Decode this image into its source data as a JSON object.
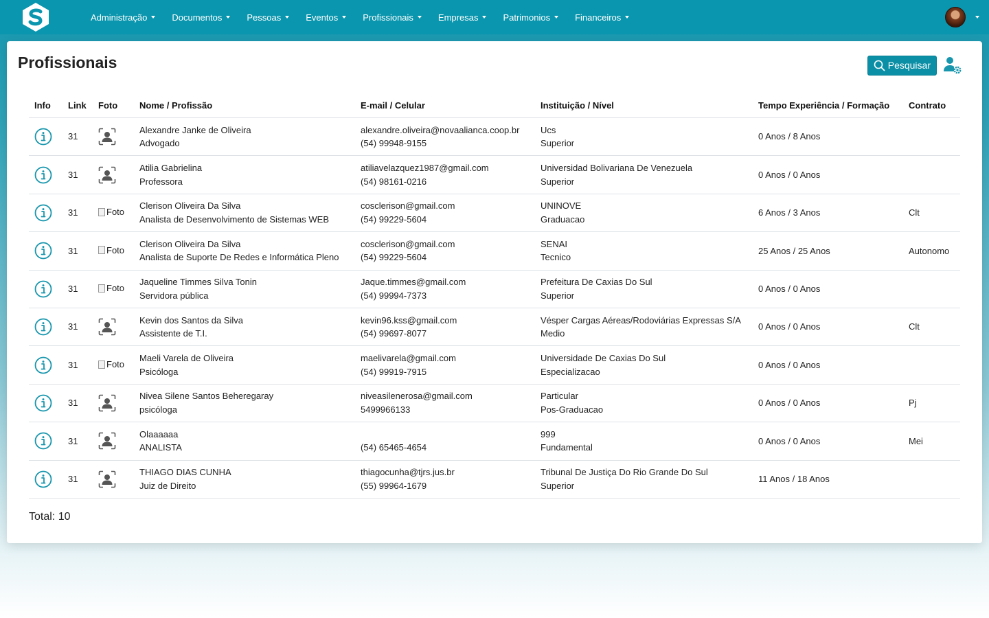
{
  "nav": {
    "items": [
      "Administração",
      "Documentos",
      "Pessoas",
      "Eventos",
      "Profissionais",
      "Empresas",
      "Patrimonios",
      "Financeiros"
    ]
  },
  "page": {
    "title": "Profissionais",
    "search_label": "Pesquisar",
    "total_label": "Total: 10"
  },
  "colors": {
    "accent": "#0a96ae",
    "button": "#0a8fa6",
    "icon": "#1796ad"
  },
  "table": {
    "headers": [
      "Info",
      "Link",
      "Foto",
      "Nome / Profissão",
      "E-mail / Celular",
      "Instituição / Nível",
      "Tempo Experiência / Formação",
      "Contrato"
    ],
    "broken_photo_alt": "Foto",
    "rows": [
      {
        "link": "31",
        "photo": "placeholder",
        "name": "Alexandre Janke de Oliveira",
        "profession": "Advogado",
        "email": "alexandre.oliveira@novaalianca.coop.br",
        "phone": "(54) 99948-9155",
        "institution": "Ucs",
        "level": "Superior",
        "time": "0 Anos / 8 Anos",
        "contract": ""
      },
      {
        "link": "31",
        "photo": "placeholder",
        "name": "Atilia Gabrielina",
        "profession": "Professora",
        "email": "atiliavelazquez1987@gmail.com",
        "phone": "(54) 98161-0216",
        "institution": "Universidad Bolivariana De Venezuela",
        "level": "Superior",
        "time": "0 Anos / 0 Anos",
        "contract": ""
      },
      {
        "link": "31",
        "photo": "broken",
        "name": "Clerison Oliveira Da Silva",
        "profession": "Analista de Desenvolvimento de Sistemas WEB",
        "email": "cosclerison@gmail.com",
        "phone": "(54) 99229-5604",
        "institution": "UNINOVE",
        "level": "Graduacao",
        "time": "6 Anos / 3 Anos",
        "contract": "Clt"
      },
      {
        "link": "31",
        "photo": "broken",
        "name": "Clerison Oliveira Da Silva",
        "profession": "Analista de Suporte De Redes e Informática Pleno",
        "email": "cosclerison@gmail.com",
        "phone": "(54) 99229-5604",
        "institution": "SENAI",
        "level": "Tecnico",
        "time": "25 Anos / 25 Anos",
        "contract": "Autonomo"
      },
      {
        "link": "31",
        "photo": "broken",
        "name": "Jaqueline Timmes Silva Tonin",
        "profession": "Servidora pública",
        "email": "Jaque.timmes@gmail.com",
        "phone": "(54) 99994-7373",
        "institution": "Prefeitura De Caxias Do Sul",
        "level": "Superior",
        "time": "0 Anos / 0 Anos",
        "contract": ""
      },
      {
        "link": "31",
        "photo": "placeholder",
        "name": "Kevin dos Santos da Silva",
        "profession": "Assistente de T.I.",
        "email": "kevin96.kss@gmail.com",
        "phone": "(54) 99697-8077",
        "institution": "Vésper Cargas Aéreas/Rodoviárias Expressas S/A",
        "level": "Medio",
        "time": "0 Anos / 0 Anos",
        "contract": "Clt"
      },
      {
        "link": "31",
        "photo": "broken",
        "name": "Maeli Varela de Oliveira",
        "profession": "Psicóloga",
        "email": "maelivarela@gmail.com",
        "phone": "(54) 99919-7915",
        "institution": "Universidade De Caxias Do Sul",
        "level": "Especializacao",
        "time": "0 Anos / 0 Anos",
        "contract": ""
      },
      {
        "link": "31",
        "photo": "placeholder",
        "name": "Nivea Silene Santos Beheregaray",
        "profession": "psicóloga",
        "email": "niveasilenerosa@gmail.com",
        "phone": "5499966133",
        "institution": "Particular",
        "level": "Pos-Graduacao",
        "time": "0 Anos / 0 Anos",
        "contract": "Pj"
      },
      {
        "link": "31",
        "photo": "placeholder",
        "name": "Olaaaaaa",
        "profession": "ANALISTA",
        "email": "",
        "phone": "(54) 65465-4654",
        "institution": "999",
        "level": "Fundamental",
        "time": "0 Anos / 0 Anos",
        "contract": "Mei"
      },
      {
        "link": "31",
        "photo": "placeholder",
        "name": "THIAGO DIAS CUNHA",
        "profession": "Juiz de Direito",
        "email": "thiagocunha@tjrs.jus.br",
        "phone": "(55) 99964-1679",
        "institution": "Tribunal De Justiça Do Rio Grande Do Sul",
        "level": "Superior",
        "time": "11 Anos / 18 Anos",
        "contract": ""
      }
    ]
  }
}
